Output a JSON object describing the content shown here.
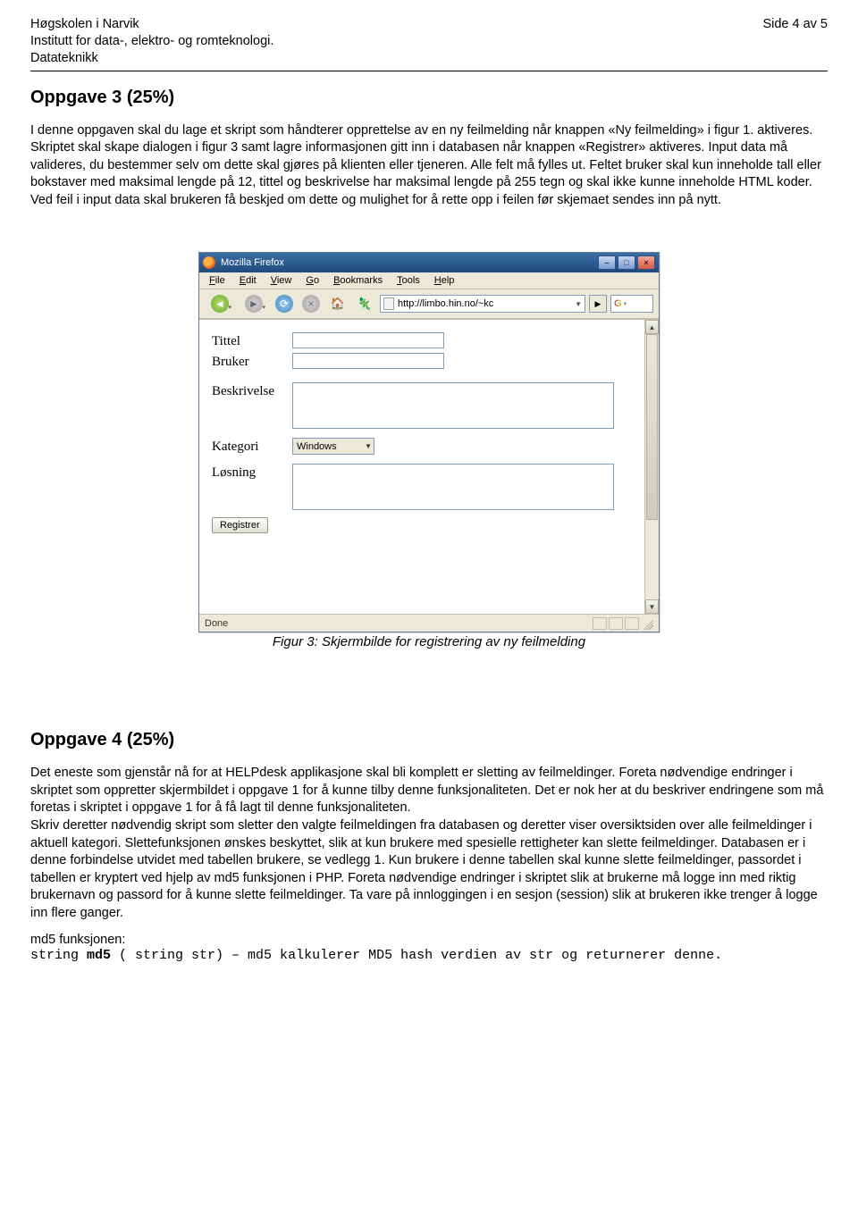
{
  "header": {
    "institution": "Høgskolen i Narvik",
    "department": "Institutt for data-, elektro- og romteknologi.",
    "program": "Datateknikk",
    "page_label": "Side 4 av 5"
  },
  "task3": {
    "title": "Oppgave 3 (25%)",
    "body": "I denne oppgaven skal du lage et skript som håndterer opprettelse av en ny feilmelding når knappen «Ny feilmelding» i figur 1. aktiveres. Skriptet skal skape dialogen i figur 3 samt lagre informasjonen gitt inn i databasen når knappen «Registrer» aktiveres. Input data må valideres, du bestemmer selv om dette skal gjøres på klienten eller tjeneren. Alle felt må fylles ut. Feltet bruker skal kun inneholde tall eller bokstaver med maksimal lengde på 12, tittel og beskrivelse har maksimal lengde på 255 tegn og skal ikke kunne inneholde HTML koder. Ved feil i input data skal brukeren få beskjed om dette og mulighet for å rette opp i feilen før skjemaet sendes inn på nytt."
  },
  "figure3": {
    "caption": "Figur 3: Skjermbilde for registrering av ny feilmelding",
    "browser": {
      "title": "Mozilla Firefox",
      "menu": {
        "file": "File",
        "edit": "Edit",
        "view": "View",
        "go": "Go",
        "bookmarks": "Bookmarks",
        "tools": "Tools",
        "help": "Help"
      },
      "url": "http://limbo.hin.no/~kc",
      "status": "Done"
    },
    "form": {
      "tittel_label": "Tittel",
      "bruker_label": "Bruker",
      "beskrivelse_label": "Beskrivelse",
      "kategori_label": "Kategori",
      "kategori_value": "Windows",
      "losning_label": "Løsning",
      "registrer_label": "Registrer"
    }
  },
  "task4": {
    "title": "Oppgave 4 (25%)",
    "body": "Det eneste som gjenstår nå for at HELPdesk applikasjone skal bli komplett er sletting av feilmeldinger. Foreta nødvendige endringer i skriptet som oppretter skjermbildet i oppgave 1 for å kunne tilby denne funksjonaliteten. Det er nok her at du beskriver endringene som må foretas i skriptet i oppgave 1 for å få lagt til denne funksjonaliteten.\nSkriv deretter nødvendig skript som sletter den valgte feilmeldingen fra databasen og deretter viser oversiktsiden over alle feilmeldinger i aktuell kategori. Slettefunksjonen ønskes beskyttet, slik at kun brukere med spesielle rettigheter kan slette feilmeldinger. Databasen er i denne forbindelse utvidet med tabellen brukere, se vedlegg 1. Kun brukere i denne tabellen skal kunne slette feilmeldinger, passordet i tabellen er kryptert ved hjelp av md5 funksjonen i PHP. Foreta nødvendige endringer i skriptet slik at brukerne må logge inn med riktig brukernavn og passord for å kunne slette feilmeldinger. Ta vare på innloggingen i en sesjon (session) slik at brukeren ikke trenger å logge inn flere ganger.",
    "md5_label": "md5 funksjonen:",
    "md5_sig_prefix": "string ",
    "md5_sig_bold": "md5",
    "md5_sig_suffix": " ( string str) – md5 kalkulerer MD5 hash verdien av str og returnerer denne."
  }
}
